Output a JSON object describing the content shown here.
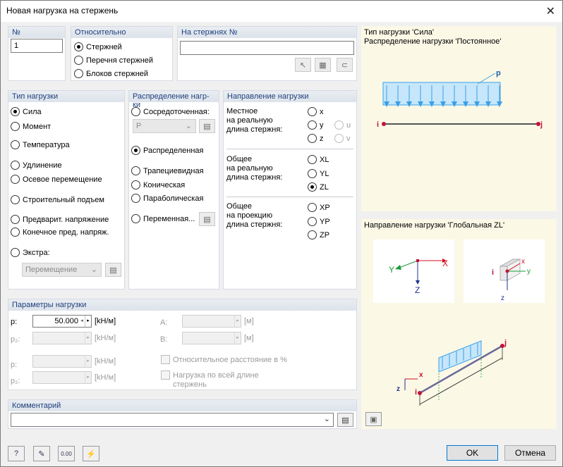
{
  "window": {
    "title": "Новая нагрузка на стержень"
  },
  "number": {
    "title": "№",
    "value": "1"
  },
  "relative": {
    "title": "Относительно",
    "options": [
      "Стержней",
      "Перечня стержней",
      "Блоков стержней"
    ],
    "selected": 0
  },
  "on_members": {
    "title": "На стержнях №",
    "value": ""
  },
  "load_type": {
    "title": "Тип нагрузки",
    "options": [
      "Сила",
      "Момент",
      "Температура",
      "Удлинение",
      "Осевое перемещение",
      "Строительный подъем",
      "Предварит. напряжение",
      "Конечное пред. напряж.",
      "Экстра:"
    ],
    "selected": 0,
    "extra_combo": "Перемещение"
  },
  "distribution": {
    "title": "Распределение нагр-ки",
    "concentrated": "Сосредоточенная:",
    "concentrated_combo": "P",
    "distributed": "Распределенная",
    "trapezoidal": "Трапециевидная",
    "conical": "Коническая",
    "parabolic": "Параболическая",
    "variable": "Переменная...",
    "selected": "distributed"
  },
  "direction": {
    "title": "Направление нагрузки",
    "local_label": "Местное\nна реальную\nдлина стержня:",
    "local_options": [
      "x",
      "y",
      "z",
      "u",
      "v"
    ],
    "global_true_label": "Общее\nна реальную\nдлина стержня:",
    "global_true_options": [
      "XL",
      "YL",
      "ZL"
    ],
    "global_proj_label": "Общее\nна проекцию\nдлина стержня:",
    "global_proj_options": [
      "XP",
      "YP",
      "ZP"
    ],
    "selected": "ZL"
  },
  "params": {
    "title": "Параметры нагрузки",
    "p_label": "p:",
    "p_value": "50.000",
    "p_unit": "[kH/м]",
    "p2_label": "p₂:",
    "p2_unit": "[kH/м]",
    "p_b_label": "p:",
    "p_b_unit": "[kH/м]",
    "p2_b_label": "p₂:",
    "p2_b_unit": "[kH/м]",
    "a_label": "A:",
    "a_unit": "[м]",
    "b_label": "B:",
    "b_unit": "[м]",
    "relative_distance": "Относительное расстояние в %",
    "full_length": "Нагрузка по всей длине",
    "full_length_2": "стержень"
  },
  "comment": {
    "title": "Комментарий",
    "value": ""
  },
  "info_pane": {
    "line1": "Тип нагрузки 'Сила'",
    "line2": "Распределение нагрузки 'Постоянное'",
    "p_label": "p",
    "i_label": "i",
    "j_label": "j"
  },
  "direction_pane": {
    "title": "Направление нагрузки 'Глобальная ZL'",
    "axis_y": "Y",
    "axis_x": "X",
    "axis_z": "Z",
    "local_x": "x",
    "local_y": "y",
    "local_z": "z",
    "i_label": "i",
    "j_label": "j"
  },
  "buttons": {
    "ok": "OK",
    "cancel": "Отмена"
  },
  "colors": {
    "accent": "#0078d7",
    "load": "#3aa0e6",
    "header_text": "#1f3f7a",
    "pane_bg": "#fbf8e6"
  }
}
